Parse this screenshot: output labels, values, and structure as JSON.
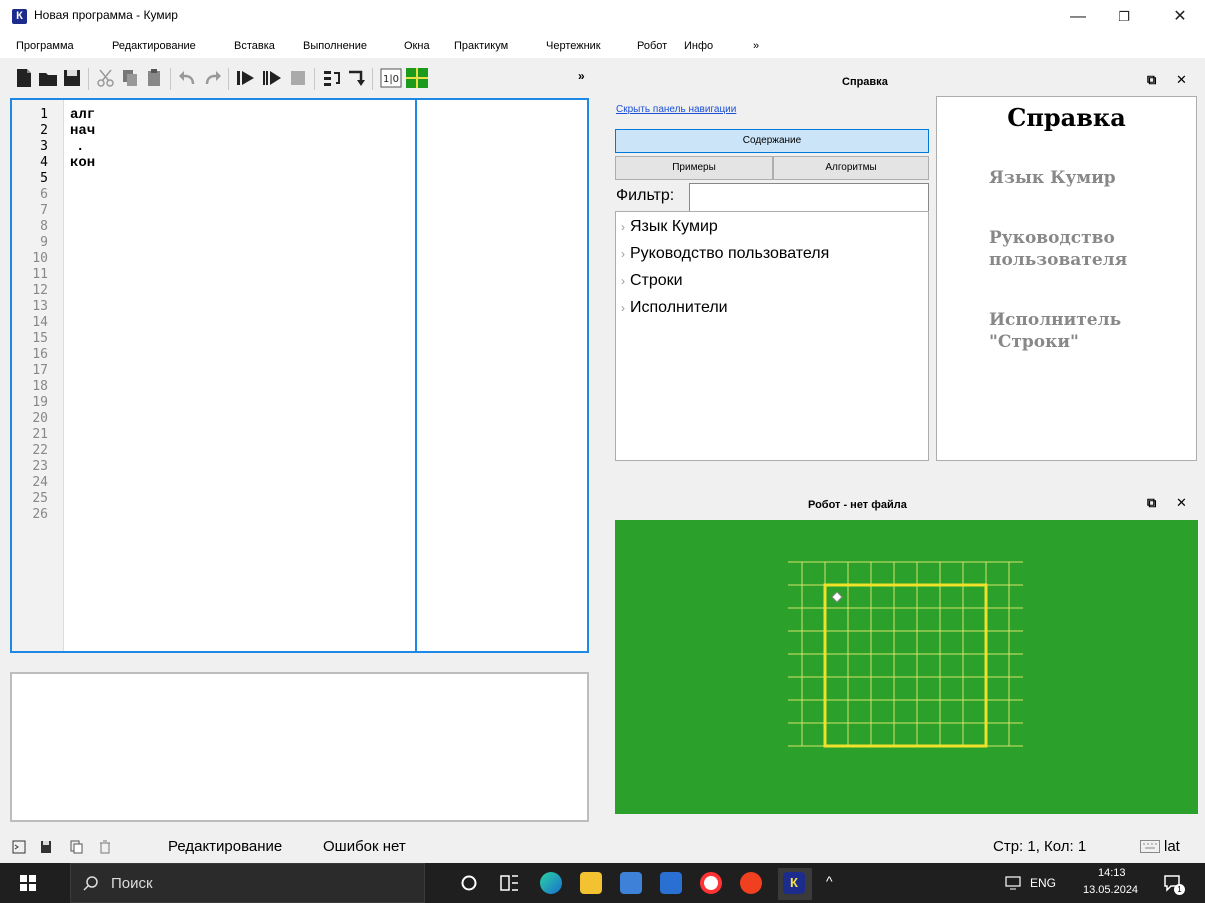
{
  "window": {
    "title": "Новая программа - Кумир",
    "app_icon_letter": "К"
  },
  "menu": [
    "Программа",
    "Редактирование",
    "Вставка",
    "Выполнение",
    "Окна",
    "Практикум",
    "Чертежник",
    "Робот",
    "Инфо",
    "»"
  ],
  "toolbar": {
    "overflow": "»"
  },
  "editor": {
    "line_numbers": [
      "1",
      "2",
      "3",
      "4",
      "5",
      "6",
      "7",
      "8",
      "9",
      "10",
      "11",
      "12",
      "13",
      "14",
      "15",
      "16",
      "17",
      "18",
      "19",
      "20",
      "21",
      "22",
      "23",
      "24",
      "25",
      "26"
    ],
    "code_lines": [
      "алг",
      "нач",
      ".",
      "кон"
    ]
  },
  "help": {
    "panel_title": "Справка",
    "hide_nav_link": "Скрыть панель навигации",
    "btn_contents": "Содержание",
    "btn_examples": "Примеры",
    "btn_algorithms": "Алгоритмы",
    "filter_label": "Фильтр:",
    "filter_value": "",
    "tree": [
      "Язык Кумир",
      "Руководство пользователя",
      "Строки",
      "Исполнители"
    ],
    "view_heading": "Справка",
    "view_links": [
      "Язык Кумир",
      "Руководство\nпользователя",
      "Исполнитель\n\"Строки\""
    ]
  },
  "robot": {
    "panel_title": "Робот - нет файла",
    "field": {
      "cols": 9,
      "rows": 8,
      "wall_box_cols": 7,
      "wall_box_rows": 7,
      "robot_col": 1,
      "robot_row": 1
    },
    "colors": {
      "field": "#2ba02b",
      "grid": "#d6e26a",
      "wall": "#f2e12b",
      "robot": "#ffffff"
    }
  },
  "status": {
    "mode": "Редактирование",
    "errors": "Ошибок нет",
    "position": "Стр: 1, Кол: 1",
    "layout": "lat"
  },
  "taskbar": {
    "search": "Поиск",
    "lang": "ENG",
    "time": "14:13",
    "date": "13.05.2024",
    "notification_count": "1",
    "kumir_letter": "К"
  }
}
